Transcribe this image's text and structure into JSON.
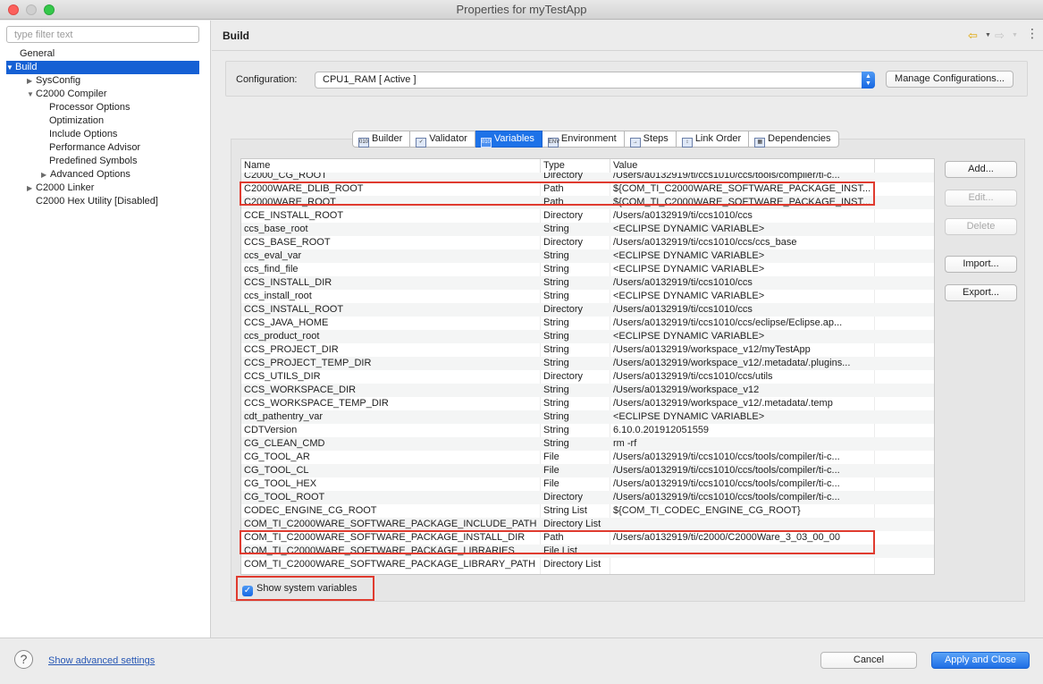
{
  "window": {
    "title": "Properties for myTestApp"
  },
  "sidebar": {
    "filter_placeholder": "type filter text",
    "items": [
      {
        "label": "General",
        "twisty": ""
      },
      {
        "label": "Build",
        "twisty": "▼"
      },
      {
        "label": "SysConfig",
        "twisty": "▶"
      },
      {
        "label": "C2000 Compiler",
        "twisty": "▼"
      },
      {
        "label": "Processor Options",
        "twisty": ""
      },
      {
        "label": "Optimization",
        "twisty": ""
      },
      {
        "label": "Include Options",
        "twisty": ""
      },
      {
        "label": "Performance Advisor",
        "twisty": ""
      },
      {
        "label": "Predefined Symbols",
        "twisty": ""
      },
      {
        "label": "Advanced Options",
        "twisty": "▶"
      },
      {
        "label": "C2000 Linker",
        "twisty": "▶"
      },
      {
        "label": "C2000 Hex Utility  [Disabled]",
        "twisty": ""
      }
    ]
  },
  "header": {
    "title": "Build"
  },
  "config": {
    "label": "Configuration:",
    "value": "CPU1_RAM  [ Active ]",
    "manage_label": "Manage Configurations..."
  },
  "tabs": [
    {
      "label": "Builder",
      "icon": "builder-icon",
      "glyph": "010"
    },
    {
      "label": "Validator",
      "icon": "validator-icon",
      "glyph": "✓"
    },
    {
      "label": "Variables",
      "icon": "variables-icon",
      "glyph": "010"
    },
    {
      "label": "Environment",
      "icon": "environment-icon",
      "glyph": "ENV"
    },
    {
      "label": "Steps",
      "icon": "steps-icon",
      "glyph": "→"
    },
    {
      "label": "Link Order",
      "icon": "link-order-icon",
      "glyph": "↕"
    },
    {
      "label": "Dependencies",
      "icon": "dependencies-icon",
      "glyph": "▦"
    }
  ],
  "table": {
    "columns": [
      "Name",
      "Type",
      "Value"
    ],
    "rows": [
      [
        "C2000_CG_ROOT",
        "Directory",
        "/Users/a0132919/ti/ccs1010/ccs/tools/compiler/ti-c..."
      ],
      [
        "C2000WARE_DLIB_ROOT",
        "Path",
        "${COM_TI_C2000WARE_SOFTWARE_PACKAGE_INST..."
      ],
      [
        "C2000WARE_ROOT",
        "Path",
        "${COM_TI_C2000WARE_SOFTWARE_PACKAGE_INST..."
      ],
      [
        "CCE_INSTALL_ROOT",
        "Directory",
        "/Users/a0132919/ti/ccs1010/ccs"
      ],
      [
        "ccs_base_root",
        "String",
        "<ECLIPSE DYNAMIC VARIABLE>"
      ],
      [
        "CCS_BASE_ROOT",
        "Directory",
        "/Users/a0132919/ti/ccs1010/ccs/ccs_base"
      ],
      [
        "ccs_eval_var",
        "String",
        "<ECLIPSE DYNAMIC VARIABLE>"
      ],
      [
        "ccs_find_file",
        "String",
        "<ECLIPSE DYNAMIC VARIABLE>"
      ],
      [
        "CCS_INSTALL_DIR",
        "String",
        "/Users/a0132919/ti/ccs1010/ccs"
      ],
      [
        "ccs_install_root",
        "String",
        "<ECLIPSE DYNAMIC VARIABLE>"
      ],
      [
        "CCS_INSTALL_ROOT",
        "Directory",
        "/Users/a0132919/ti/ccs1010/ccs"
      ],
      [
        "CCS_JAVA_HOME",
        "String",
        "/Users/a0132919/ti/ccs1010/ccs/eclipse/Eclipse.ap..."
      ],
      [
        "ccs_product_root",
        "String",
        "<ECLIPSE DYNAMIC VARIABLE>"
      ],
      [
        "CCS_PROJECT_DIR",
        "String",
        "/Users/a0132919/workspace_v12/myTestApp"
      ],
      [
        "CCS_PROJECT_TEMP_DIR",
        "String",
        "/Users/a0132919/workspace_v12/.metadata/.plugins..."
      ],
      [
        "CCS_UTILS_DIR",
        "Directory",
        "/Users/a0132919/ti/ccs1010/ccs/utils"
      ],
      [
        "CCS_WORKSPACE_DIR",
        "String",
        "/Users/a0132919/workspace_v12"
      ],
      [
        "CCS_WORKSPACE_TEMP_DIR",
        "String",
        "/Users/a0132919/workspace_v12/.metadata/.temp"
      ],
      [
        "cdt_pathentry_var",
        "String",
        "<ECLIPSE DYNAMIC VARIABLE>"
      ],
      [
        "CDTVersion",
        "String",
        "6.10.0.201912051559"
      ],
      [
        "CG_CLEAN_CMD",
        "String",
        "rm -rf"
      ],
      [
        "CG_TOOL_AR",
        "File",
        "/Users/a0132919/ti/ccs1010/ccs/tools/compiler/ti-c..."
      ],
      [
        "CG_TOOL_CL",
        "File",
        "/Users/a0132919/ti/ccs1010/ccs/tools/compiler/ti-c..."
      ],
      [
        "CG_TOOL_HEX",
        "File",
        "/Users/a0132919/ti/ccs1010/ccs/tools/compiler/ti-c..."
      ],
      [
        "CG_TOOL_ROOT",
        "Directory",
        "/Users/a0132919/ti/ccs1010/ccs/tools/compiler/ti-c..."
      ],
      [
        "CODEC_ENGINE_CG_ROOT",
        "String List",
        "${COM_TI_CODEC_ENGINE_CG_ROOT}"
      ],
      [
        "COM_TI_C2000WARE_SOFTWARE_PACKAGE_INCLUDE_PATH",
        "Directory List",
        ""
      ],
      [
        "COM_TI_C2000WARE_SOFTWARE_PACKAGE_INSTALL_DIR",
        "Path",
        "/Users/a0132919/ti/c2000/C2000Ware_3_03_00_00"
      ],
      [
        "COM_TI_C2000WARE_SOFTWARE_PACKAGE_LIBRARIES",
        "File List",
        ""
      ],
      [
        "COM_TI_C2000WARE_SOFTWARE_PACKAGE_LIBRARY_PATH",
        "Directory List",
        ""
      ]
    ]
  },
  "side_buttons": {
    "add": "Add...",
    "edit": "Edit...",
    "delete": "Delete",
    "import": "Import...",
    "export": "Export..."
  },
  "show_system": {
    "label": "Show system variables",
    "checked": true
  },
  "footer": {
    "advanced_link": "Show advanced settings",
    "cancel": "Cancel",
    "apply_close": "Apply and Close"
  }
}
